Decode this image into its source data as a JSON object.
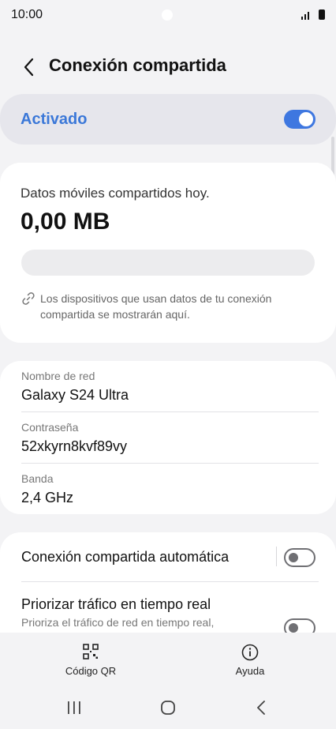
{
  "status_bar": {
    "time": "10:00",
    "icons": [
      "signal-icon",
      "battery-icon"
    ]
  },
  "header": {
    "title": "Conexión compartida",
    "back_icon": "back-icon"
  },
  "master_switch": {
    "label": "Activado",
    "state": "on",
    "accent_color": "#3e77e0"
  },
  "usage": {
    "label": "Datos móviles compartidos hoy.",
    "value": "0,00 MB",
    "progress_fraction": 0,
    "info_text": "Los dispositivos que usan datos de tu conexión compartida se mostrarán aquí.",
    "info_icon": "link-icon"
  },
  "network": {
    "rows": [
      {
        "label": "Nombre de red",
        "value": "Galaxy S24 Ultra"
      },
      {
        "label": "Contraseña",
        "value": "52xkyrn8kvf89vy"
      },
      {
        "label": "Banda",
        "value": "2,4 GHz"
      }
    ]
  },
  "settings": {
    "auto_hotspot": {
      "title": "Conexión compartida automática",
      "state": "off"
    },
    "prioritize": {
      "title": "Priorizar tráfico en tiempo real",
      "subtitle": "Prioriza el tráfico de red en tiempo real,",
      "state": "off"
    }
  },
  "bottom_actions": [
    {
      "label": "Código QR",
      "icon": "qr-code-icon"
    },
    {
      "label": "Ayuda",
      "icon": "info-icon"
    }
  ],
  "nav": {
    "icons": [
      "recents-icon",
      "home-icon",
      "back-nav-icon"
    ]
  }
}
